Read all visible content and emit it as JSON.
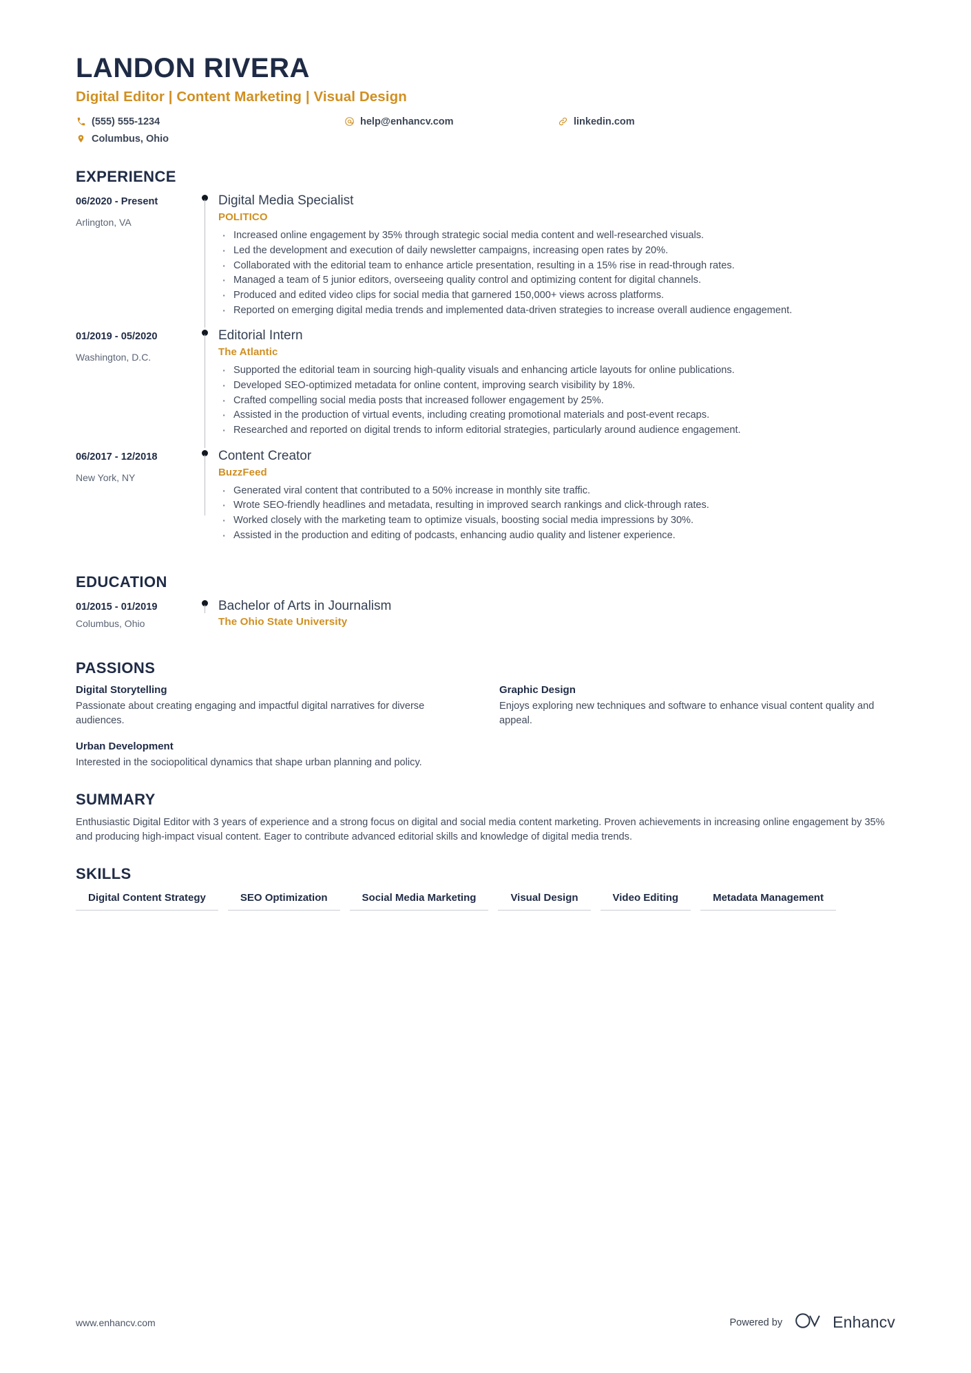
{
  "header": {
    "name": "LANDON RIVERA",
    "title": "Digital Editor | Content Marketing | Visual Design",
    "contacts": [
      {
        "icon": "phone-icon",
        "text": "(555) 555-1234"
      },
      {
        "icon": "email-icon",
        "text": "help@enhancv.com"
      },
      {
        "icon": "link-icon",
        "text": "linkedin.com"
      },
      {
        "icon": "location-pin-icon",
        "text": "Columbus, Ohio"
      }
    ]
  },
  "experience": {
    "heading": "EXPERIENCE",
    "entries": [
      {
        "date": "06/2020 - Present",
        "location": "Arlington, VA",
        "role": "Digital Media Specialist",
        "org": "POLITICO",
        "bullets": [
          "Increased online engagement by 35% through strategic social media content and well-researched visuals.",
          "Led the development and execution of daily newsletter campaigns, increasing open rates by 20%.",
          "Collaborated with the editorial team to enhance article presentation, resulting in a 15% rise in read-through rates.",
          "Managed a team of 5 junior editors, overseeing quality control and optimizing content for digital channels.",
          "Produced and edited video clips for social media that garnered 150,000+ views across platforms.",
          "Reported on emerging digital media trends and implemented data-driven strategies to increase overall audience engagement."
        ]
      },
      {
        "date": "01/2019 - 05/2020",
        "location": "Washington, D.C.",
        "role": "Editorial Intern",
        "org": "The Atlantic",
        "bullets": [
          "Supported the editorial team in sourcing high-quality visuals and enhancing article layouts for online publications.",
          "Developed SEO-optimized metadata for online content, improving search visibility by 18%.",
          "Crafted compelling social media posts that increased follower engagement by 25%.",
          "Assisted in the production of virtual events, including creating promotional materials and post-event recaps.",
          "Researched and reported on digital trends to inform editorial strategies, particularly around audience engagement."
        ]
      },
      {
        "date": "06/2017 - 12/2018",
        "location": "New York, NY",
        "role": "Content Creator",
        "org": "BuzzFeed",
        "bullets": [
          "Generated viral content that contributed to a 50% increase in monthly site traffic.",
          "Wrote SEO-friendly headlines and metadata, resulting in improved search rankings and click-through rates.",
          "Worked closely with the marketing team to optimize visuals, boosting social media impressions by 30%.",
          "Assisted in the production and editing of podcasts, enhancing audio quality and listener experience."
        ]
      }
    ]
  },
  "education": {
    "heading": "EDUCATION",
    "entries": [
      {
        "date": "01/2015 - 01/2019",
        "location": "Columbus, Ohio",
        "degree": "Bachelor of Arts in Journalism",
        "school": "The Ohio State University"
      }
    ]
  },
  "passions": {
    "heading": "PASSIONS",
    "items": [
      {
        "title": "Digital Storytelling",
        "description": "Passionate about creating engaging and impactful digital narratives for diverse audiences."
      },
      {
        "title": "Graphic Design",
        "description": "Enjoys exploring new techniques and software to enhance visual content quality and appeal."
      },
      {
        "title": "Urban Development",
        "description": "Interested in the sociopolitical dynamics that shape urban planning and policy."
      }
    ]
  },
  "summary": {
    "heading": "SUMMARY",
    "text": "Enthusiastic Digital Editor with 3 years of experience and a strong focus on digital and social media content marketing. Proven achievements in increasing online engagement by 35% and producing high-impact visual content. Eager to contribute advanced editorial skills and knowledge of digital media trends."
  },
  "skills": {
    "heading": "SKILLS",
    "items": [
      "Digital Content Strategy",
      "SEO Optimization",
      "Social Media Marketing",
      "Visual Design",
      "Video Editing",
      "Metadata Management"
    ]
  },
  "footer": {
    "url": "www.enhancv.com",
    "powered_by": "Powered by",
    "brand": "Enhancv"
  },
  "colors": {
    "accent": "#d08f21",
    "ink": "#1f2b45",
    "body": "#414b5c"
  }
}
